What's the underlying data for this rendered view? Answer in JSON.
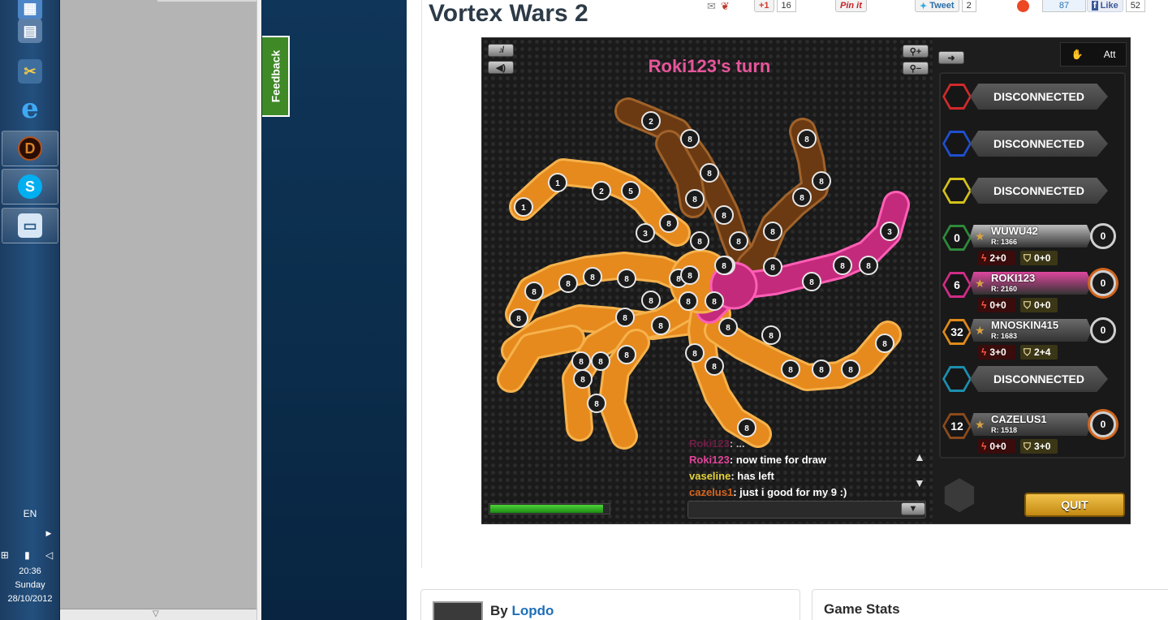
{
  "taskbar": {
    "language": "EN",
    "time": "20:36",
    "day": "Sunday",
    "date": "28/10/2012",
    "pinned_icons": [
      "computer-icon",
      "network-icon",
      "tools-icon",
      "internet-explorer-icon",
      "diablo-icon",
      "skype-icon",
      "remote-desktop-icon"
    ]
  },
  "feedback_tab": {
    "label": "Feedback"
  },
  "page": {
    "title": "Vortex Wars 2",
    "share": {
      "gplus_label": "+1",
      "gplus_count": "16",
      "pinterest_label": "Pin it",
      "tweet_label": "Tweet",
      "tweet_count": "2",
      "stumble_count": "87",
      "like_label": "Like",
      "like_count": "52"
    },
    "author_prefix": "By",
    "author_name": "Lopdo",
    "game_stats_title": "Game Stats"
  },
  "game": {
    "turn_text": "Roki123's turn",
    "top_right_label": "Att",
    "energy_fraction": 0.95,
    "quit_label": "QUIT",
    "slots": [
      {
        "kind": "disconnected",
        "label": "DISCONNECTED",
        "color": "#d12a2a"
      },
      {
        "kind": "disconnected",
        "label": "DISCONNECTED",
        "color": "#1f4fd0"
      },
      {
        "kind": "disconnected",
        "label": "DISCONNECTED",
        "color": "#d4c21a"
      },
      {
        "kind": "player",
        "count": "0",
        "name": "WUWU42",
        "rating": "R: 1366",
        "ring": "0",
        "attack": "2+0",
        "defense": "0+0",
        "color": "#2e8b3a",
        "bar": "#bdbdbd"
      },
      {
        "kind": "player",
        "count": "6",
        "name": "ROKI123",
        "rating": "R: 2160",
        "ring": "0",
        "attack": "0+0",
        "defense": "0+0",
        "color": "#d02c86",
        "bar": "#e0479f"
      },
      {
        "kind": "player",
        "count": "32",
        "name": "MNOSKIN415",
        "rating": "R: 1683",
        "ring": "0",
        "attack": "3+0",
        "defense": "2+4",
        "color": "#e08a1a",
        "bar": "#6b6b6b"
      },
      {
        "kind": "disconnected",
        "label": "DISCONNECTED",
        "color": "#1c8fb0"
      },
      {
        "kind": "player",
        "count": "12",
        "name": "CAZELUS1",
        "rating": "R: 1518",
        "ring": "0",
        "attack": "0+0",
        "defense": "3+0",
        "color": "#8b4a1c",
        "bar": "#6b6b6b"
      }
    ],
    "chat": [
      {
        "name": "Roki123",
        "msg": ": ...",
        "color": "#8e1d55"
      },
      {
        "name": "Roki123",
        "msg": ": now time for draw",
        "color": "#e0449a"
      },
      {
        "name": "vaseline",
        "msg": ": has left",
        "color": "#e5d43b"
      },
      {
        "name": "cazelus1",
        "msg": ": just i good for my 9 :)",
        "color": "#d6641f"
      }
    ],
    "cells": [
      {
        "v": "2",
        "o": "brown"
      },
      {
        "v": "8",
        "o": "brown"
      },
      {
        "v": "8",
        "o": "brown"
      },
      {
        "v": "8",
        "o": "brown"
      },
      {
        "v": "8",
        "o": "brown"
      },
      {
        "v": "8",
        "o": "brown"
      },
      {
        "v": "8",
        "o": "brown"
      },
      {
        "v": "8",
        "o": "brown"
      },
      {
        "v": "8",
        "o": "brown"
      },
      {
        "v": "1",
        "o": "orange"
      },
      {
        "v": "2",
        "o": "orange"
      },
      {
        "v": "5",
        "o": "orange"
      },
      {
        "v": "1",
        "o": "orange"
      },
      {
        "v": "3",
        "o": "orange"
      },
      {
        "v": "8",
        "o": "orange"
      },
      {
        "v": "8",
        "o": "brown"
      },
      {
        "v": "3",
        "o": "pink"
      },
      {
        "v": "8",
        "o": "orange"
      },
      {
        "v": "8",
        "o": "orange"
      },
      {
        "v": "8",
        "o": "orange"
      },
      {
        "v": "8",
        "o": "orange"
      },
      {
        "v": "8",
        "o": "orange"
      },
      {
        "v": "8",
        "o": "pink"
      },
      {
        "v": "8",
        "o": "brown"
      },
      {
        "v": "8",
        "o": "brown"
      },
      {
        "v": "8",
        "o": "brown"
      },
      {
        "v": "8",
        "o": "brown"
      },
      {
        "v": "8",
        "o": "orange"
      },
      {
        "v": "8",
        "o": "orange"
      },
      {
        "v": "8",
        "o": "orange"
      },
      {
        "v": "8",
        "o": "orange"
      },
      {
        "v": "8",
        "o": "pink"
      },
      {
        "v": "8",
        "o": "orange"
      },
      {
        "v": "8",
        "o": "orange"
      },
      {
        "v": "8",
        "o": "orange"
      },
      {
        "v": "8",
        "o": "orange"
      },
      {
        "v": "8",
        "o": "orange"
      },
      {
        "v": "8",
        "o": "orange"
      },
      {
        "v": "8",
        "o": "orange"
      },
      {
        "v": "8",
        "o": "orange"
      },
      {
        "v": "8",
        "o": "orange"
      },
      {
        "v": "8",
        "o": "orange"
      },
      {
        "v": "8",
        "o": "orange"
      },
      {
        "v": "8",
        "o": "orange"
      },
      {
        "v": "8",
        "o": "orange"
      },
      {
        "v": "8",
        "o": "orange"
      },
      {
        "v": "8",
        "o": "orange"
      },
      {
        "v": "8",
        "o": "orange"
      },
      {
        "v": "8",
        "o": "orange"
      },
      {
        "v": "8",
        "o": "orange"
      }
    ]
  }
}
